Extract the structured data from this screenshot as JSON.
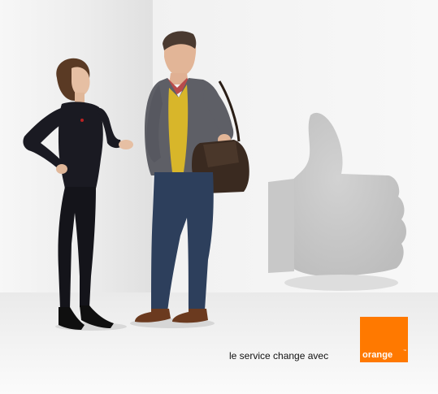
{
  "ad": {
    "tagline": "le service change avec",
    "logo_text": "orange",
    "logo_trademark": "™"
  },
  "colors": {
    "brand": "#ff7900",
    "background": "#ffffff",
    "wall": "#f2f2f2",
    "floor": "#f4f4f4",
    "shadow": "#c4c4c4"
  },
  "icons": {
    "logo": "orange-logo-square",
    "thumbs_up_shadow": "thumbs-up-shadow"
  }
}
